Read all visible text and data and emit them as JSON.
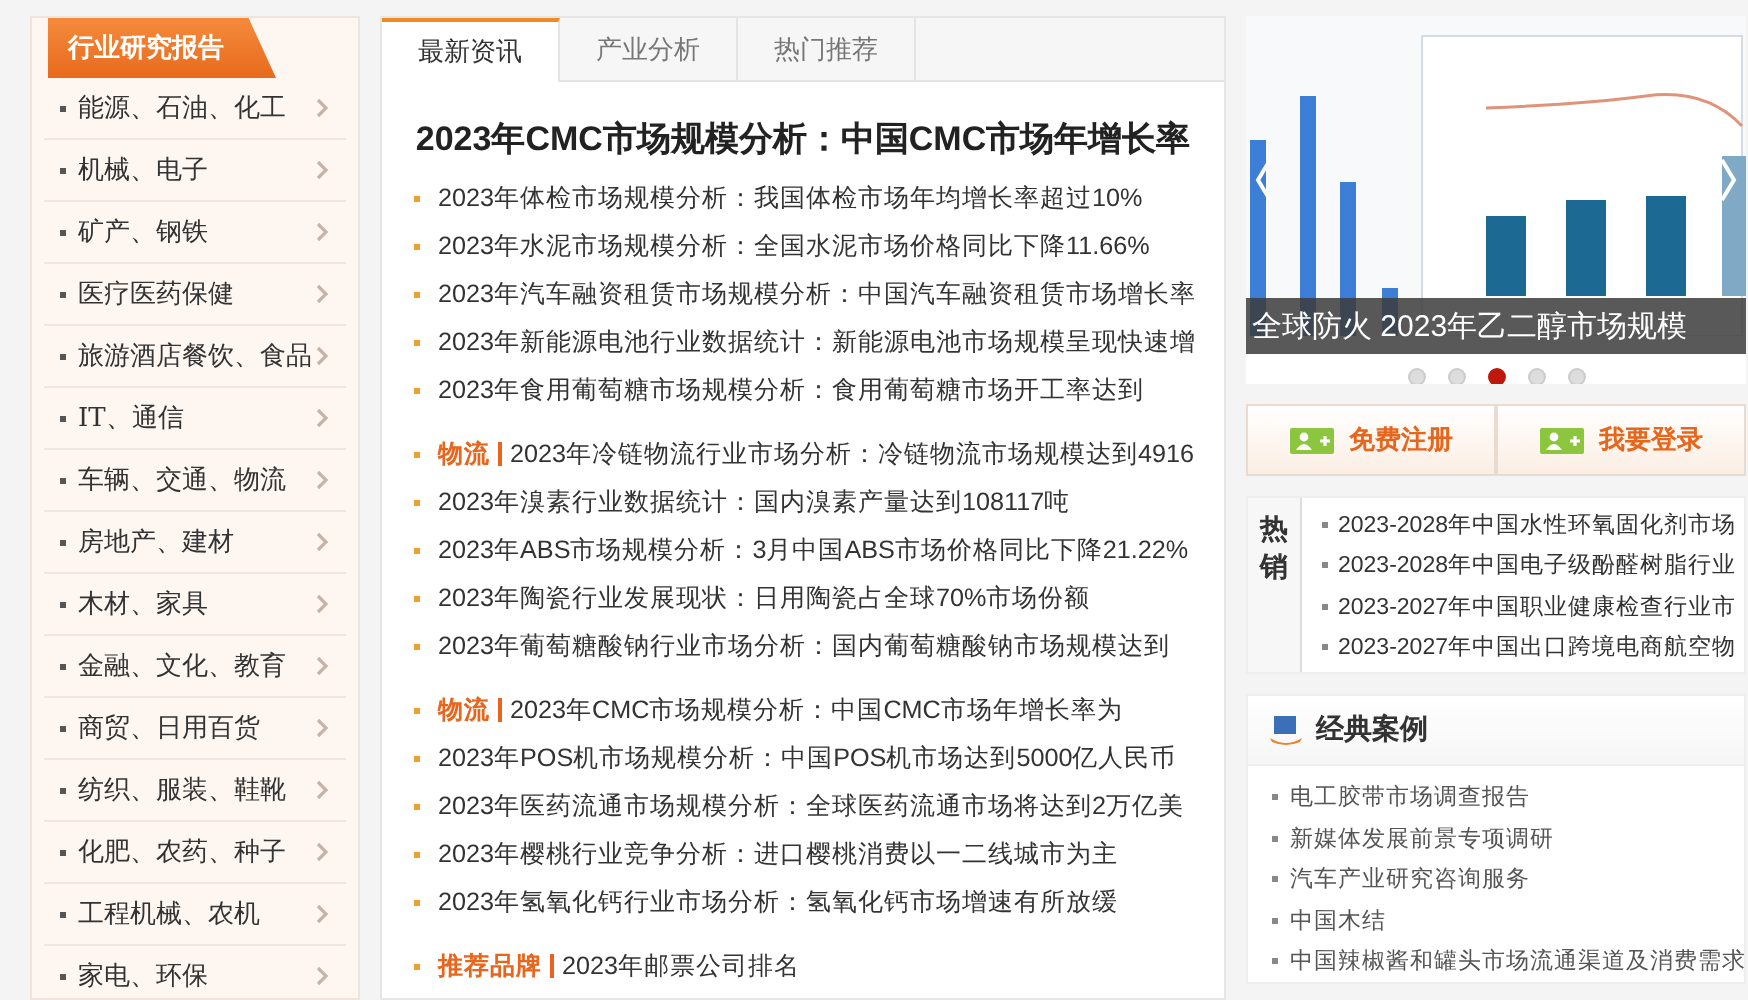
{
  "sidebar": {
    "title": "行业研究报告",
    "items": [
      {
        "label": "能源、石油、化工"
      },
      {
        "label": "机械、电子"
      },
      {
        "label": "矿产、钢铁"
      },
      {
        "label": "医疗医药保健"
      },
      {
        "label": "旅游酒店餐饮、食品"
      },
      {
        "label": "IT、通信"
      },
      {
        "label": "车辆、交通、物流"
      },
      {
        "label": "房地产、建材"
      },
      {
        "label": "木材、家具"
      },
      {
        "label": "金融、文化、教育"
      },
      {
        "label": "商贸、日用百货"
      },
      {
        "label": "纺织、服装、鞋靴"
      },
      {
        "label": "化肥、农药、种子"
      },
      {
        "label": "工程机械、农机"
      },
      {
        "label": "家电、环保"
      }
    ]
  },
  "news": {
    "tabs": [
      {
        "label": "最新资讯",
        "selected": true
      },
      {
        "label": "产业分析",
        "selected": false
      },
      {
        "label": "热门推荐",
        "selected": false
      }
    ],
    "headline": "2023年CMC市场规模分析：中国CMC市场年增长率",
    "groups": [
      {
        "items": [
          {
            "text": "2023年体检市场规模分析：我国体检市场年均增长率超过10%"
          },
          {
            "text": "2023年水泥市场规模分析：全国水泥市场价格同比下降11.66%"
          },
          {
            "text": "2023年汽车融资租赁市场规模分析：中国汽车融资租赁市场增长率"
          },
          {
            "text": "2023年新能源电池行业数据统计：新能源电池市场规模呈现快速增"
          },
          {
            "text": "2023年食用葡萄糖市场规模分析：食用葡萄糖市场开工率达到"
          }
        ]
      },
      {
        "items": [
          {
            "tag": "物流",
            "text": "2023年冷链物流行业市场分析：冷链物流市场规模达到4916"
          },
          {
            "text": "2023年溴素行业数据统计：国内溴素产量达到108117吨"
          },
          {
            "text": "2023年ABS市场规模分析：3月中国ABS市场价格同比下降21.22%"
          },
          {
            "text": "2023年陶瓷行业发展现状：日用陶瓷占全球70%市场份额"
          },
          {
            "text": "2023年葡萄糖酸钠行业市场分析：国内葡萄糖酸钠市场规模达到"
          }
        ]
      },
      {
        "items": [
          {
            "tag": "物流",
            "text": "2023年CMC市场规模分析：中国CMC市场年增长率为"
          },
          {
            "text": "2023年POS机市场规模分析：中国POS机市场达到5000亿人民币"
          },
          {
            "text": "2023年医药流通市场规模分析：全球医药流通市场将达到2万亿美"
          },
          {
            "text": "2023年樱桃行业竞争分析：进口樱桃消费以一二线城市为主"
          },
          {
            "text": "2023年氢氧化钙行业市场分析：氢氧化钙市场增速有所放缓"
          }
        ]
      },
      {
        "items": [
          {
            "tag": "推荐品牌",
            "text": "2023年邮票公司排名"
          }
        ]
      }
    ]
  },
  "carousel": {
    "caption": "全球防火 2023年乙二醇市场规模",
    "dots": [
      {
        "selected": false
      },
      {
        "selected": false
      },
      {
        "selected": true
      },
      {
        "selected": false
      },
      {
        "selected": false
      }
    ]
  },
  "account_buttons": [
    {
      "label": "免费注册"
    },
    {
      "label": "我要登录"
    }
  ],
  "hot": {
    "title": "热销",
    "items": [
      {
        "text": "2023-2028年中国水性环氧固化剂市场"
      },
      {
        "text": "2023-2028年中国电子级酚醛树脂行业"
      },
      {
        "text": "2023-2027年中国职业健康检查行业市"
      },
      {
        "text": "2023-2027年中国出口跨境电商航空物"
      }
    ]
  },
  "cases": {
    "title": "经典案例",
    "items": [
      {
        "text": "电工胶带市场调查报告"
      },
      {
        "text": "新媒体发展前景专项调研"
      },
      {
        "text": "汽车产业研究咨询服务"
      },
      {
        "text": "中国木结"
      },
      {
        "text": "中国辣椒酱和罐头市场流通渠道及消费需求"
      }
    ]
  }
}
